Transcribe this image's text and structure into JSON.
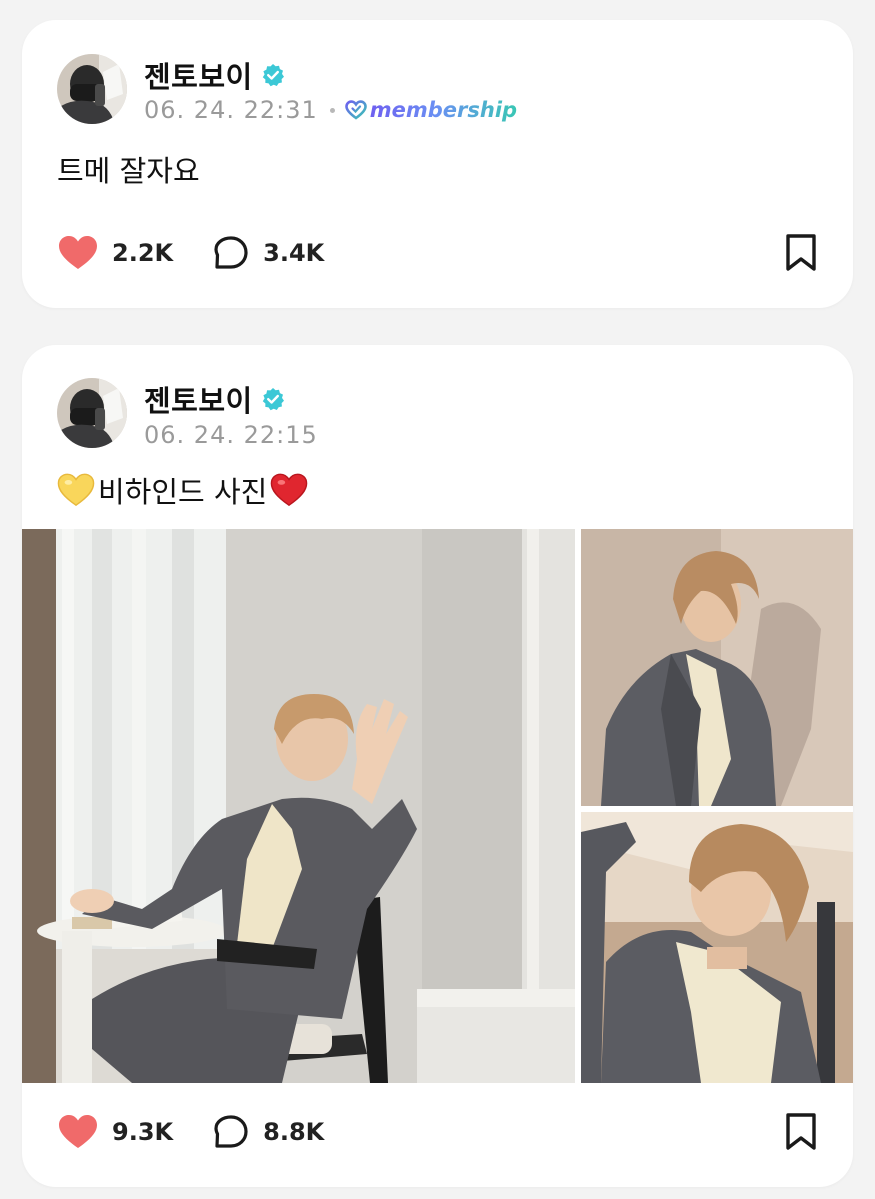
{
  "posts": [
    {
      "author": "젠토보이",
      "timestamp": "06. 24. 22:31",
      "membership_label": "membership",
      "text": "트메 잘자요",
      "likes": "2.2K",
      "comments": "3.4K"
    },
    {
      "author": "젠토보이",
      "timestamp": "06. 24. 22:15",
      "text_prefix_emoji": "💛",
      "text": "비하인드 사진",
      "text_suffix_emoji": "❤️",
      "likes": "9.3K",
      "comments": "8.8K"
    }
  ],
  "colors": {
    "background": "#f3f3f3",
    "card": "#ffffff",
    "heart": "#f06a6a",
    "verified": "#3cc8d6",
    "timestamp": "#9a9a9a"
  },
  "icons": {
    "like": "heart-icon",
    "comment": "speech-bubble-icon",
    "save": "bookmark-icon",
    "verified": "verified-badge-icon",
    "membership": "membership-heart-icon"
  }
}
